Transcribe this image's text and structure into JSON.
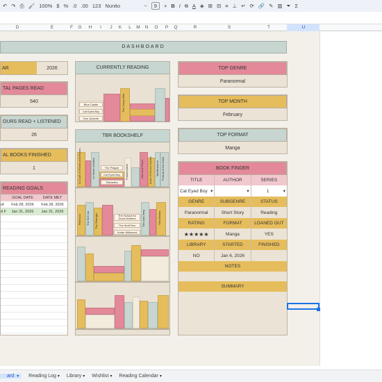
{
  "toolbar": {
    "zoom": "100%",
    "currency": "$",
    "percent": "%",
    "decimal_dec": ".0",
    "decimal_inc": ".00",
    "number_format": "123",
    "font": "Nunito",
    "font_size": "9",
    "bold": "B",
    "italic": "I",
    "strike": "S",
    "text_color": "A",
    "sum": "Σ"
  },
  "columns": [
    "D",
    "E",
    "F",
    "G",
    "H",
    "I",
    "J",
    "K",
    "L",
    "M",
    "N",
    "O",
    "P",
    "Q",
    "R",
    "S",
    "T",
    "U"
  ],
  "dashboard": {
    "title": "DASHBOARD"
  },
  "left_cards": {
    "year_label": "AR",
    "year_value": "2026",
    "pages_label": "TAL PAGES READ",
    "pages_value": "540",
    "hours_label": "OURS READ + LISTENED",
    "hours_value": "26",
    "books_label": "AL BOOKS FINISHED",
    "books_value": "1",
    "goals_label": "READING GOALS",
    "goals_col_goal": "GOAL DATE",
    "goals_col_met": "DATE MET",
    "goals_rows": [
      {
        "name": "of",
        "goal": "Feb 28, 2026",
        "met": "Feb 28, 2026"
      },
      {
        "name": "d F",
        "goal": "Jan 31, 2026",
        "met": "Jan 31, 2026"
      }
    ]
  },
  "currently_reading": {
    "title": "CURRENTLY READING",
    "labels": [
      "Blue Castle",
      "Cat Eyed Boy",
      "Don Quixote"
    ],
    "tall_title": "The Crazy Man"
  },
  "tbr": {
    "title": "TBR BOOKSHELF",
    "shelf1_labels": [
      "A Court of Thorns and Roses",
      "Le Morte d'Arthur",
      "The Plague",
      "Cat Eyed Boy",
      "Siddartha",
      "Frankenstein",
      "War and Peace",
      "Anne of Green Gables",
      "Middlemarch",
      "Portrait of the Artist"
    ],
    "shelf2_labels": [
      "Rebecca",
      "The Bell Jar",
      "The Stranger",
      "The School for Good Mothers",
      "The Wolf Den",
      "Under Milkwood",
      "Tom and Jerry",
      "War Beasts"
    ]
  },
  "top_genre": {
    "label": "TOP GENRE",
    "value": "Paranormal"
  },
  "top_month": {
    "label": "TOP MONTH",
    "value": "February"
  },
  "top_format": {
    "label": "TOP FORMAT",
    "value": "Manga"
  },
  "finder": {
    "title": "BOOK FINDER",
    "h1": [
      "TITLE",
      "AUTHOR",
      "SERIES"
    ],
    "v1": [
      "Cat Eyed Boy",
      "",
      "1"
    ],
    "h2": [
      "GENRE",
      "SUBGENRE",
      "STATUS"
    ],
    "v2": [
      "Paranormal",
      "Short Story",
      "Reading"
    ],
    "h3": [
      "RATING",
      "FORMAT",
      "LOANED OUT"
    ],
    "v3": [
      "★★★★★",
      "Manga",
      "YES"
    ],
    "h4": [
      "LIBRARY",
      "STARTED",
      "FINISHED"
    ],
    "v4": [
      "NO",
      "Jan 6, 2026",
      ""
    ],
    "notes": "NOTES",
    "summary": "SUMMARY"
  },
  "tabs": [
    "ard",
    "Reading Log",
    "Library",
    "Wishlist",
    "Reading Calendar"
  ],
  "colors": {
    "pink": "#e3899a",
    "yellow": "#e6bd5c",
    "sage": "#c7d6d0",
    "cream": "#ebe3d6"
  }
}
